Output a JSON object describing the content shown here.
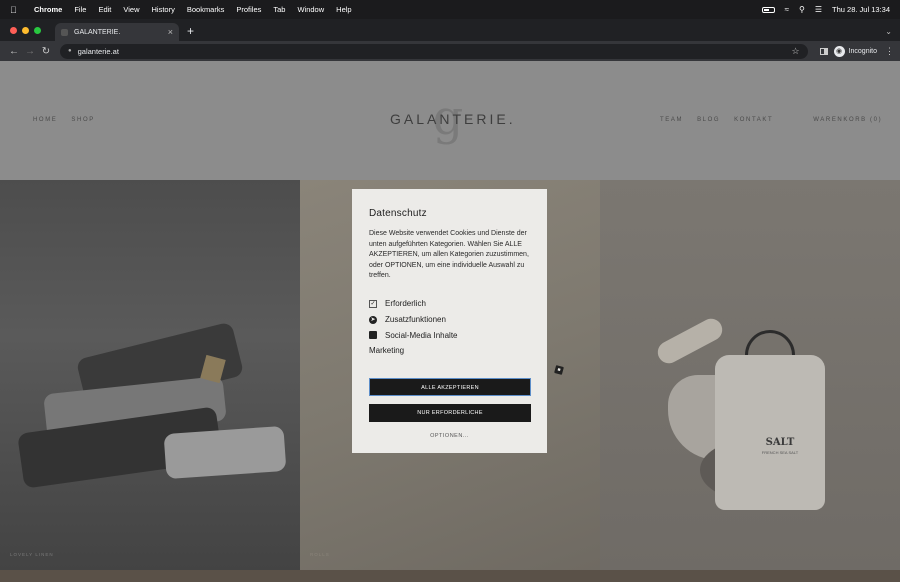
{
  "menubar": {
    "app": "Chrome",
    "items": [
      "File",
      "Edit",
      "View",
      "History",
      "Bookmarks",
      "Profiles",
      "Tab",
      "Window",
      "Help"
    ],
    "clock": "Thu 28. Jul  13:34"
  },
  "browser": {
    "tab_title": "GALANTERIE.",
    "url": "galanterie.at",
    "profile_label": "Incognito"
  },
  "site": {
    "logo_mark": "g",
    "logo": "GALANTERIE.",
    "nav_left": [
      "HOME",
      "SHOP"
    ],
    "nav_right": [
      "TEAM",
      "BLOG",
      "KONTAKT"
    ],
    "cart": "WARENKORB (0)",
    "caption_left": "LOVELY LINEN",
    "caption_mid": "ROLLS",
    "bag_title": "SALT",
    "bag_subtitle": "FRENCH SEA SALT"
  },
  "consent": {
    "title": "Datenschutz",
    "description": "Diese Website verwendet Cookies und Dienste der unten aufgeführten Kategorien. Wählen Sie ALLE AKZEPTIEREN, um allen Kategorien zuzustimmen, oder OPTIONEN, um eine individuelle Auswahl zu treffen.",
    "categories": [
      {
        "label": "Erforderlich",
        "icon": "checkbox-icon"
      },
      {
        "label": "Zusatzfunktionen",
        "icon": "compass-icon"
      },
      {
        "label": "Social-Media Inhalte",
        "icon": "stack-icon"
      },
      {
        "label": "Marketing",
        "icon": "ad-icon"
      }
    ],
    "accept_all": "ALLE AKZEPTIEREN",
    "required_only": "NUR ERFORDERLICHE",
    "options": "OPTIONEN..."
  },
  "colors": {
    "modal_bg": "#ecebe8",
    "button_bg": "#1a1a1a",
    "focus_ring": "#5d8ec9"
  }
}
